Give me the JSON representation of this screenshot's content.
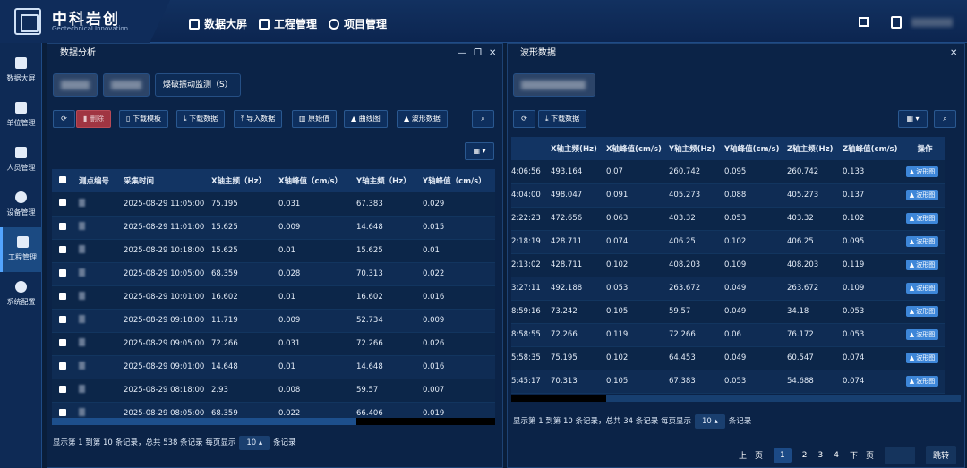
{
  "brand": {
    "title": "中科岩创",
    "subtitle": "Geotechnical Innovation"
  },
  "topnav": [
    {
      "label": "数据大屏",
      "icon": "cube-icon"
    },
    {
      "label": "工程管理",
      "icon": "monitor-icon"
    },
    {
      "label": "项目管理",
      "icon": "circle-icon"
    }
  ],
  "sidebar": [
    {
      "label": "数据大屏",
      "icon": "cube-icon"
    },
    {
      "label": "单位管理",
      "icon": "calendar-icon"
    },
    {
      "label": "人员管理",
      "icon": "person-list-icon"
    },
    {
      "label": "设备管理",
      "icon": "gear-icon"
    },
    {
      "label": "工程管理",
      "icon": "chart-icon",
      "active": true
    },
    {
      "label": "系统配置",
      "icon": "more-icon"
    }
  ],
  "left": {
    "title": "数据分析",
    "tab3": "爆破振动监测（S）",
    "buttons": [
      "删除",
      "下载模板",
      "下载数据",
      "导入数据",
      "原始值",
      "曲线图",
      "波形数据"
    ],
    "columns": [
      "测点编号",
      "采集时间",
      "X轴主频（Hz）",
      "X轴峰值（cm/s）",
      "Y轴主频（Hz）",
      "Y轴峰值（cm/s）"
    ],
    "rows": [
      [
        "2025-08-29 11:05:00",
        "75.195",
        "0.031",
        "67.383",
        "0.029"
      ],
      [
        "2025-08-29 11:01:00",
        "15.625",
        "0.009",
        "14.648",
        "0.015"
      ],
      [
        "2025-08-29 10:18:00",
        "15.625",
        "0.01",
        "15.625",
        "0.01"
      ],
      [
        "2025-08-29 10:05:00",
        "68.359",
        "0.028",
        "70.313",
        "0.022"
      ],
      [
        "2025-08-29 10:01:00",
        "16.602",
        "0.01",
        "16.602",
        "0.016"
      ],
      [
        "2025-08-29 09:18:00",
        "11.719",
        "0.009",
        "52.734",
        "0.009"
      ],
      [
        "2025-08-29 09:05:00",
        "72.266",
        "0.031",
        "72.266",
        "0.026"
      ],
      [
        "2025-08-29 09:01:00",
        "14.648",
        "0.01",
        "14.648",
        "0.016"
      ],
      [
        "2025-08-29 08:18:00",
        "2.93",
        "0.008",
        "59.57",
        "0.007"
      ],
      [
        "2025-08-29 08:05:00",
        "68.359",
        "0.022",
        "66.406",
        "0.019"
      ]
    ],
    "footer_a": "显示第 1 到第 10 条记录，总共 538 条记录 每页显示",
    "page_size": "10",
    "footer_b": "条记录"
  },
  "right": {
    "title": "波形数据",
    "download": "下载数据",
    "columns": [
      "",
      "X轴主频(Hz)",
      "X轴峰值(cm/s)",
      "Y轴主频(Hz)",
      "Y轴峰值(cm/s)",
      "Z轴主频(Hz)",
      "Z轴峰值(cm/s)",
      "操作"
    ],
    "rows": [
      [
        "4:06:56",
        "493.164",
        "0.07",
        "260.742",
        "0.095",
        "260.742",
        "0.133"
      ],
      [
        "4:04:00",
        "498.047",
        "0.091",
        "405.273",
        "0.088",
        "405.273",
        "0.137"
      ],
      [
        "2:22:23",
        "472.656",
        "0.063",
        "403.32",
        "0.053",
        "403.32",
        "0.102"
      ],
      [
        "2:18:19",
        "428.711",
        "0.074",
        "406.25",
        "0.102",
        "406.25",
        "0.095"
      ],
      [
        "2:13:02",
        "428.711",
        "0.102",
        "408.203",
        "0.109",
        "408.203",
        "0.119"
      ],
      [
        "3:27:11",
        "492.188",
        "0.053",
        "263.672",
        "0.049",
        "263.672",
        "0.109"
      ],
      [
        "8:59:16",
        "73.242",
        "0.105",
        "59.57",
        "0.049",
        "34.18",
        "0.053"
      ],
      [
        "8:58:55",
        "72.266",
        "0.119",
        "72.266",
        "0.06",
        "76.172",
        "0.053"
      ],
      [
        "5:58:35",
        "75.195",
        "0.102",
        "64.453",
        "0.049",
        "60.547",
        "0.074"
      ],
      [
        "5:45:17",
        "70.313",
        "0.105",
        "67.383",
        "0.053",
        "54.688",
        "0.074"
      ]
    ],
    "row_action": "波形图",
    "footer_a": "显示第 1 到第 10 条记录，总共 34 条记录 每页显示",
    "page_size": "10",
    "footer_b": "条记录",
    "pager": {
      "prev": "上一页",
      "pages": [
        "1",
        "2",
        "3",
        "4"
      ],
      "next": "下一页",
      "jump": "跳转"
    }
  }
}
